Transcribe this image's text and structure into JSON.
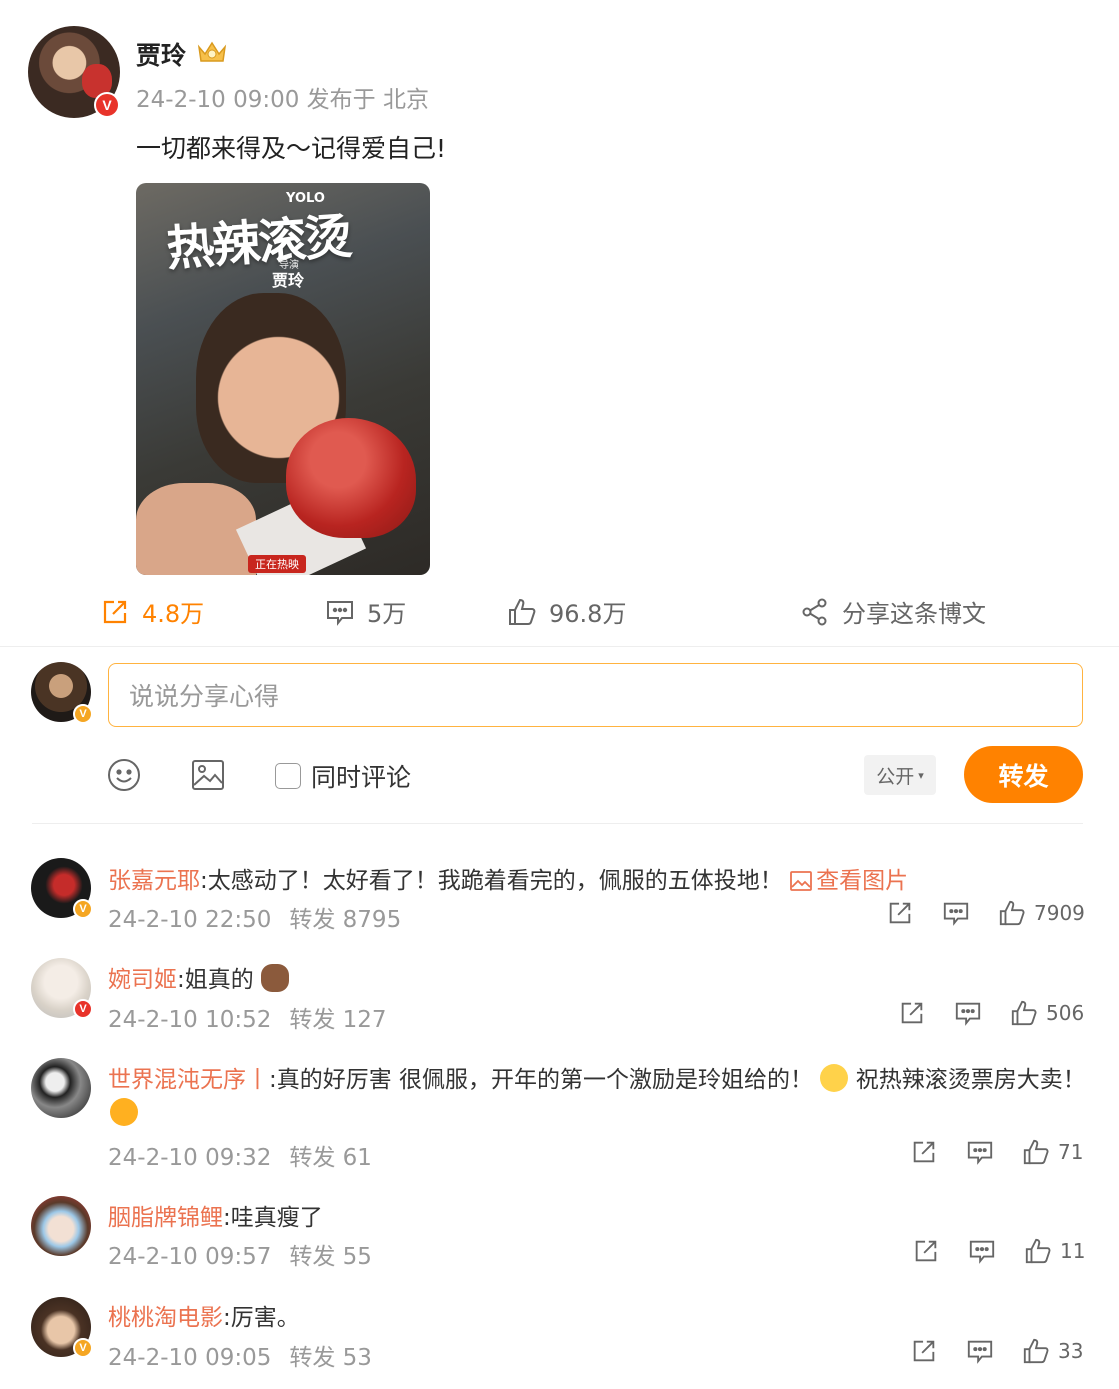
{
  "post": {
    "author": "贾玲",
    "meta": "24-2-10 09:00 发布于 北京",
    "text": "一切都来得及～记得爱自己!",
    "poster": {
      "yolo": "YOLO",
      "title": "热辣滚烫",
      "director_label": "导演",
      "director": "贾玲",
      "tag": "正在热映"
    }
  },
  "actions": {
    "repost": "4.8万",
    "comment": "5万",
    "like": "96.8万",
    "share": "分享这条博文"
  },
  "compose": {
    "placeholder": "说说分享心得",
    "also_comment": "同时评论",
    "visibility": "公开",
    "submit": "转发"
  },
  "comments": [
    {
      "user": "张嘉元耶",
      "text": ":太感动了！太好看了！我跪着看完的，佩服的五体投地！",
      "image_link": "查看图片",
      "time": "24-2-10 22:50",
      "reposts": "转发 8795",
      "likes": "7909"
    },
    {
      "user": "婉司姬",
      "text": ":姐真的",
      "time": "24-2-10 10:52",
      "reposts": "转发 127",
      "likes": "506"
    },
    {
      "user": "世界混沌无序丨",
      "text": ":真的好厉害 很佩服，开年的第一个激励是玲姐给的！",
      "text2": "祝热辣滚烫票房大卖！",
      "time": "24-2-10 09:32",
      "reposts": "转发 61",
      "likes": "71"
    },
    {
      "user": "胭脂牌锦鲤",
      "text": ":哇真瘦了",
      "time": "24-2-10 09:57",
      "reposts": "转发 55",
      "likes": "11"
    },
    {
      "user": "桃桃淘电影",
      "text": ":厉害。",
      "time": "24-2-10 09:05",
      "reposts": "转发 53",
      "likes": "33"
    }
  ],
  "colors": {
    "accent": "#ff8200",
    "username": "#eb7350",
    "muted": "#999999"
  },
  "icons": [
    "crown-icon",
    "repost-icon",
    "comment-icon",
    "like-icon",
    "share-icon",
    "emoji-icon",
    "image-icon",
    "chevron-down-icon"
  ]
}
